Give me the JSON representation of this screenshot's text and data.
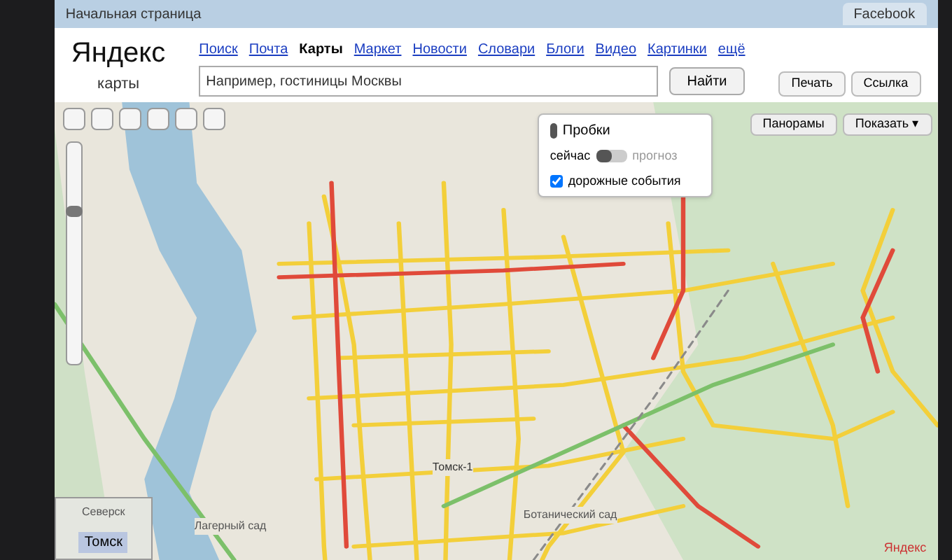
{
  "browser": {
    "bookmark": "Начальная страница",
    "tabs": [
      {
        "label": "Facebook",
        "selected": false
      }
    ]
  },
  "header": {
    "logo": "Яндекс",
    "service": "карты",
    "nav": [
      {
        "label": "Поиск",
        "selected": false
      },
      {
        "label": "Почта",
        "selected": false
      },
      {
        "label": "Карты",
        "selected": true
      },
      {
        "label": "Маркет",
        "selected": false
      },
      {
        "label": "Новости",
        "selected": false
      },
      {
        "label": "Словари",
        "selected": false
      },
      {
        "label": "Блоги",
        "selected": false
      },
      {
        "label": "Видео",
        "selected": false
      },
      {
        "label": "Картинки",
        "selected": false
      },
      {
        "label": "ещё",
        "selected": false
      }
    ],
    "search": {
      "placeholder": "Например, гостиницы Москвы",
      "button": "Найти"
    },
    "actions": [
      "Печать",
      "Ссылка"
    ]
  },
  "traffic": {
    "title": "Пробки",
    "modes": [
      {
        "label": "сейчас",
        "selected": true
      },
      {
        "label": "прогноз",
        "selected": false
      }
    ],
    "events": {
      "label": "дорожные события",
      "checked": true
    }
  },
  "map_buttons": {
    "panorama": "Панорамы",
    "show": "Показать ▾"
  },
  "map": {
    "zoom": {
      "level": 0.7
    },
    "labels": [
      "Лагерный сад",
      "Ботанический сад",
      "Томск-1"
    ],
    "minimap": {
      "city": "Томск",
      "town": "Северск"
    },
    "brand": "Яндекс"
  }
}
